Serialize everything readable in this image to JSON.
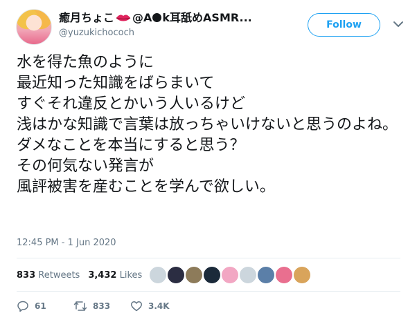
{
  "author": {
    "display_name_part1": "癒月ちょこ",
    "display_name_part2": "@A",
    "display_name_part3": "k耳舐めASMR...",
    "handle": "@yuzukichococh",
    "avatar_icon": "user-avatar"
  },
  "follow_button": {
    "label": "Follow"
  },
  "menu_icon": "chevron-down-icon",
  "tweet": {
    "text": "水を得た魚のように\n最近知った知識をばらまいて\nすぐそれ違反とかいう人いるけど\n浅はかな知識で言葉は放っちゃいけないと思うのよね。\nダメなことを本当にすると思う？\nその何気ない発言が\n風評被害を産むことを学んで欲しい。",
    "timestamp": "12:45 PM - 1 Jun 2020"
  },
  "stats": {
    "retweets_count": "833",
    "retweets_label": "Retweets",
    "likes_count": "3,432",
    "likes_label": "Likes"
  },
  "liker_avatars": [
    {
      "name": "liker-1",
      "color": "#ccd6dd"
    },
    {
      "name": "liker-2",
      "color": "#2b2d42"
    },
    {
      "name": "liker-3",
      "color": "#8d7b5a"
    },
    {
      "name": "liker-4",
      "color": "#1b2a3a"
    },
    {
      "name": "liker-5",
      "color": "#f2a7c3"
    },
    {
      "name": "liker-6",
      "color": "#ccd6dd"
    },
    {
      "name": "liker-7",
      "color": "#5b7fa8"
    },
    {
      "name": "liker-8",
      "color": "#e96f8f"
    },
    {
      "name": "liker-9",
      "color": "#d9a45b"
    }
  ],
  "actions": {
    "reply_count": "61",
    "retweet_count": "833",
    "like_count": "3.4K"
  },
  "colors": {
    "accent": "#1da1f2",
    "secondary_text": "#657786",
    "divider": "#e6ecf0"
  }
}
